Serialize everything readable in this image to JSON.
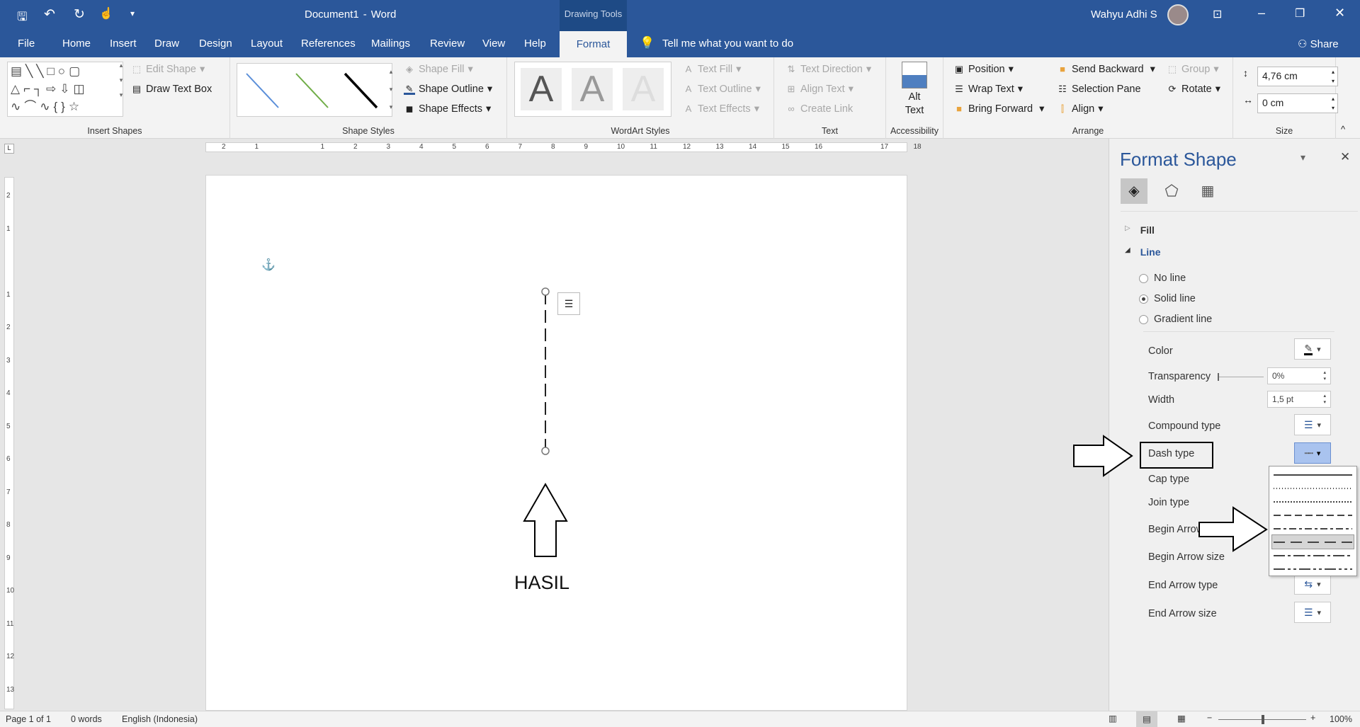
{
  "title_bar": {
    "document": "Document1",
    "separator": "-",
    "app": "Word",
    "contextual": "Drawing Tools",
    "user": "Wahyu Adhi S"
  },
  "tabs": [
    "File",
    "Home",
    "Insert",
    "Draw",
    "Design",
    "Layout",
    "References",
    "Mailings",
    "Review",
    "View",
    "Help",
    "Format"
  ],
  "active_tab": "Format",
  "tell_me": "Tell me what you want to do",
  "share": "Share",
  "ribbon": {
    "insert_shapes": {
      "label": "Insert Shapes",
      "edit_shape": "Edit Shape",
      "draw_text_box": "Draw Text Box"
    },
    "shape_styles": {
      "label": "Shape Styles",
      "shape_fill": "Shape Fill",
      "shape_outline": "Shape Outline",
      "shape_effects": "Shape Effects",
      "swatches": [
        "#5b8fd9",
        "#70ad47",
        "#000000"
      ]
    },
    "wordart_styles": {
      "label": "WordArt Styles",
      "letter": "A",
      "text_fill": "Text Fill",
      "text_outline": "Text Outline",
      "text_effects": "Text Effects"
    },
    "text": {
      "label": "Text",
      "text_direction": "Text Direction",
      "align_text": "Align Text",
      "create_link": "Create Link"
    },
    "accessibility": {
      "label": "Accessibility",
      "alt_text_1": "Alt",
      "alt_text_2": "Text"
    },
    "arrange": {
      "label": "Arrange",
      "position": "Position",
      "wrap_text": "Wrap Text",
      "bring_forward": "Bring Forward",
      "send_backward": "Send Backward",
      "selection_pane": "Selection Pane",
      "align": "Align",
      "group": "Group",
      "rotate": "Rotate"
    },
    "size": {
      "label": "Size",
      "height": "4,76 cm",
      "width": "0 cm"
    }
  },
  "ruler_h": [
    "2",
    "1",
    "",
    "1",
    "2",
    "3",
    "4",
    "5",
    "6",
    "7",
    "8",
    "9",
    "10",
    "11",
    "12",
    "13",
    "14",
    "15",
    "16",
    "",
    "17",
    "18"
  ],
  "ruler_v": [
    "2",
    "1",
    "",
    "1",
    "2",
    "3",
    "4",
    "5",
    "6",
    "7",
    "8",
    "9",
    "10",
    "11",
    "12",
    "13"
  ],
  "document": {
    "annotation": "HASIL"
  },
  "pane": {
    "title": "Format Shape",
    "fill": "Fill",
    "line": "Line",
    "radios": [
      {
        "label": "No line",
        "checked": false
      },
      {
        "label": "Solid line",
        "checked": true
      },
      {
        "label": "Gradient line",
        "checked": false
      }
    ],
    "color": "Color",
    "transparency": "Transparency",
    "transparency_value": "0%",
    "width": "Width",
    "width_value": "1,5 pt",
    "compound_type": "Compound type",
    "dash_type": "Dash type",
    "cap_type": "Cap type",
    "join_type": "Join type",
    "begin_arrow_type": "Begin Arrow type",
    "begin_arrow_size": "Begin Arrow size",
    "end_arrow_type": "End Arrow type",
    "end_arrow_size": "End Arrow size",
    "dash_options": [
      "Solid",
      "Round Dot",
      "Square Dot",
      "Dash",
      "Dash Dot",
      "Long Dash",
      "Long Dash Dot",
      "Long Dash Dot Dot"
    ],
    "dash_selected_index": 5
  },
  "status": {
    "page": "Page 1 of 1",
    "words": "0 words",
    "language": "English (Indonesia)",
    "zoom": "100%"
  },
  "colors": {
    "brand": "#2b579a",
    "pane_title": "#2b579a",
    "selected_dropdown": "#a9c3ef"
  }
}
